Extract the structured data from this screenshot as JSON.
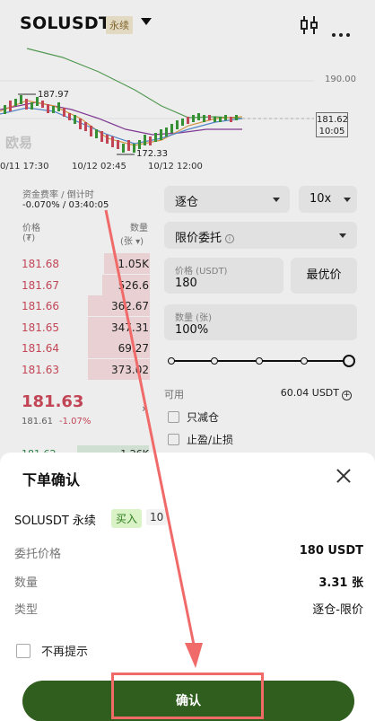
{
  "header": {
    "symbol": "SOLUSDT",
    "perp_badge": "永续"
  },
  "chart": {
    "price_levels": [
      "190.00",
      "181.62",
      "10:05"
    ],
    "high_label": "187.97",
    "low_label": "172.33",
    "time_labels": [
      "0/11 17:30",
      "10/12 02:45",
      "10/12 12:00"
    ],
    "watermark": "欧易"
  },
  "orderbook": {
    "funding_label": "资金费率 / 倒计时",
    "funding_value": "-0.070% / 03:40:05",
    "price_header": "价格",
    "price_unit": "(₮)",
    "qty_header": "数量",
    "qty_unit": "(张 ▾)",
    "asks": [
      {
        "price": "181.68",
        "qty": "1.05K",
        "depth": 0.29
      },
      {
        "price": "181.67",
        "qty": "526.6",
        "depth": 0.3
      },
      {
        "price": "181.66",
        "qty": "362.67",
        "depth": 0.39
      },
      {
        "price": "181.65",
        "qty": "347.31",
        "depth": 0.39
      },
      {
        "price": "181.64",
        "qty": "69.27",
        "depth": 0.39
      },
      {
        "price": "181.63",
        "qty": "373.02",
        "depth": 0.39
      }
    ],
    "last_price": "181.63",
    "mark_price": "181.61",
    "change": "-1.07%",
    "bids": [
      {
        "price": "181.62",
        "qty": "1.26K"
      }
    ]
  },
  "order_form": {
    "margin_mode": "逐仓",
    "leverage": "10x",
    "order_type": "限价委托",
    "price_label": "价格 (USDT)",
    "price_value": "180",
    "best_price": "最优价",
    "qty_label": "数量 (张)",
    "qty_value": "100%",
    "slider_value": 1.0,
    "available_label": "可用",
    "available_value": "60.04 USDT",
    "reduce_only": "只减仓",
    "tp_sl": "止盈/止损"
  },
  "dialog": {
    "title": "下单确认",
    "instrument": "SOLUSDT 永续",
    "side": "买入",
    "leverage": "10",
    "rows": [
      {
        "label": "委托价格",
        "value": "180 USDT"
      },
      {
        "label": "数量",
        "value": "3.31 张"
      },
      {
        "label": "类型",
        "value": "逐仓-限价"
      }
    ],
    "dont_remind": "不再提示",
    "confirm": "确认"
  },
  "colors": {
    "ask": "#d14b5d",
    "bid": "#2e8b4a",
    "confirm_button": "#2f5e1e",
    "annotation": "#f06a6a"
  }
}
